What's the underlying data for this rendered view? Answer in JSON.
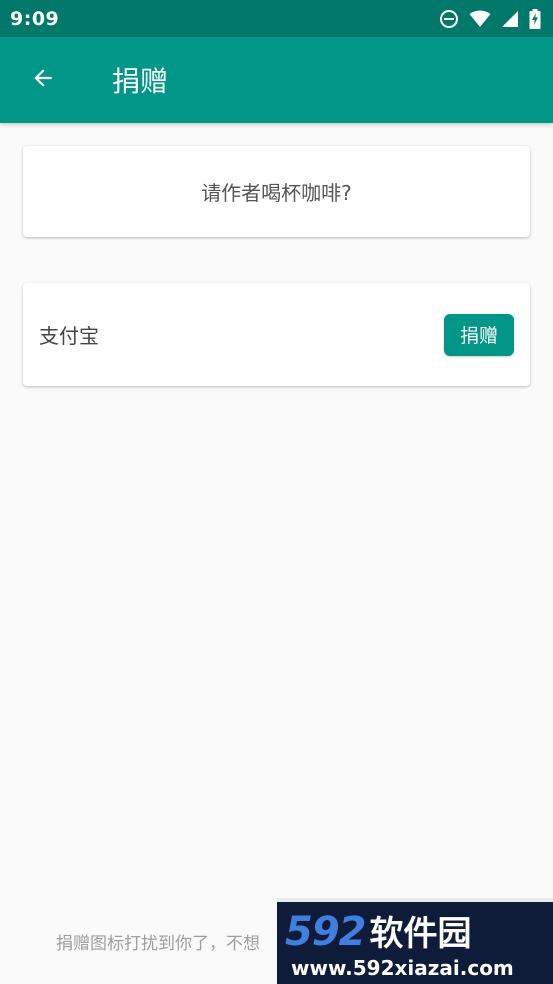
{
  "status_bar": {
    "time": "9:09",
    "icons": [
      "do-not-disturb-icon",
      "wifi-icon",
      "signal-icon",
      "battery-charging-icon"
    ]
  },
  "app_bar": {
    "back_icon": "arrow-left-icon",
    "title": "捐赠"
  },
  "prompt_card": {
    "text": "请作者喝杯咖啡?"
  },
  "payment_card": {
    "method_label": "支付宝",
    "donate_label": "捐赠"
  },
  "footer": {
    "hint": "捐赠图标打扰到你了，不想"
  },
  "watermark": {
    "logo_number": "592",
    "logo_text": "软件园",
    "url": "www.592xiazai.com"
  },
  "colors": {
    "status_bar": "#00796b",
    "primary": "#009688",
    "background": "#fafafa",
    "watermark_bg": "#0e1c3a",
    "watermark_accent": "#3f7fe0"
  }
}
